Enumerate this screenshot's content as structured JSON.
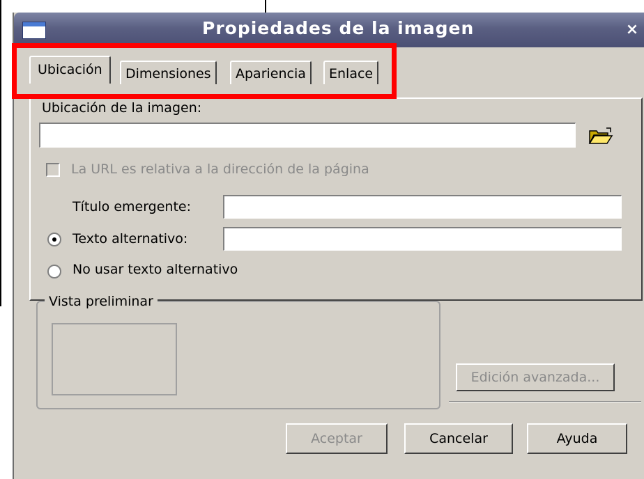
{
  "window": {
    "title": "Propiedades de la imagen",
    "close_symbol": "×"
  },
  "tabs": [
    {
      "label": "Ubicación",
      "active": true
    },
    {
      "label": "Dimensiones",
      "active": false
    },
    {
      "label": "Apariencia",
      "active": false
    },
    {
      "label": "Enlace",
      "active": false
    }
  ],
  "location": {
    "label": "Ubicación de la imagen:",
    "url_value": "",
    "relative_checkbox_label": "La URL es relativa a la dirección de la página",
    "relative_checked": false,
    "tooltip_label": "Título emergente:",
    "tooltip_value": "",
    "alt_text_label": "Texto alternativo:",
    "alt_text_value": "",
    "alt_text_selected": true,
    "no_alt_label": "No usar texto alternativo",
    "no_alt_selected": false
  },
  "preview": {
    "legend": "Vista preliminar"
  },
  "buttons": {
    "advanced_edit": "Edición avanzada...",
    "accept": "Aceptar",
    "cancel": "Cancelar",
    "help": "Ayuda"
  },
  "icons": {
    "folder": "open-folder-icon",
    "window": "window-icon"
  },
  "colors": {
    "highlight_border": "#ff0000",
    "dialog_bg": "#d4d0c8",
    "titlebar": "#5a5f82"
  }
}
